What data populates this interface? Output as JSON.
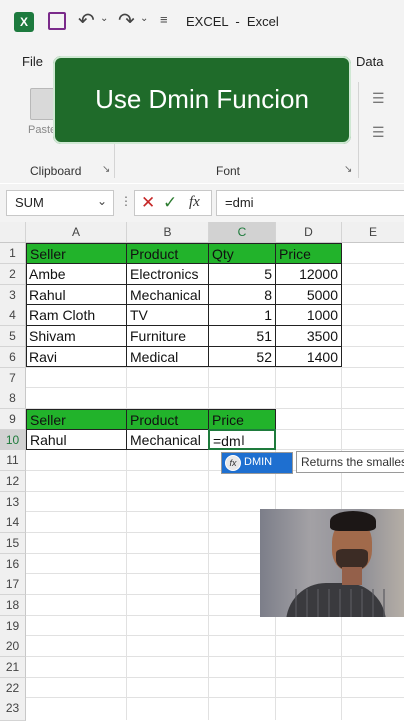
{
  "titlebar": {
    "title": "EXCEL  -  Excel"
  },
  "menu": {
    "file": "File",
    "data": "Data"
  },
  "overlay": {
    "caption": "Use Dmin Funcion"
  },
  "ribbon": {
    "clipboard_label": "Clipboard",
    "font_label": "Font",
    "paste_label": "Paste"
  },
  "formula": {
    "name_box": "SUM",
    "fx": "fx",
    "value": "=dmi"
  },
  "columns": [
    "A",
    "B",
    "C",
    "D",
    "E"
  ],
  "rows": [
    "1",
    "2",
    "3",
    "4",
    "5",
    "6",
    "7",
    "8",
    "9",
    "10",
    "11",
    "12",
    "13",
    "14",
    "15",
    "16",
    "17",
    "18",
    "19",
    "20",
    "21",
    "22",
    "23"
  ],
  "table1": {
    "headers": [
      "Seller",
      "Product",
      "Qty",
      "Price"
    ],
    "rows": [
      [
        "Ambe",
        "Electronics",
        "5",
        "12000"
      ],
      [
        "Rahul",
        "Mechanical",
        "8",
        "5000"
      ],
      [
        "Ram Cloth",
        "TV",
        "1",
        "1000"
      ],
      [
        "Shivam",
        "Furniture",
        "51",
        "3500"
      ],
      [
        "Ravi",
        "Medical",
        "52",
        "1400"
      ]
    ]
  },
  "table2": {
    "headers": [
      "Seller",
      "Product",
      "Price"
    ],
    "row": [
      "Rahul",
      "Mechanical",
      "=dm"
    ]
  },
  "autocomplete": {
    "item": "DMIN",
    "tooltip": "Returns the smalles"
  },
  "colors": {
    "header_green": "#22b32b",
    "overlay_green": "#1f6b2a",
    "select_green": "#1e7b3c"
  }
}
